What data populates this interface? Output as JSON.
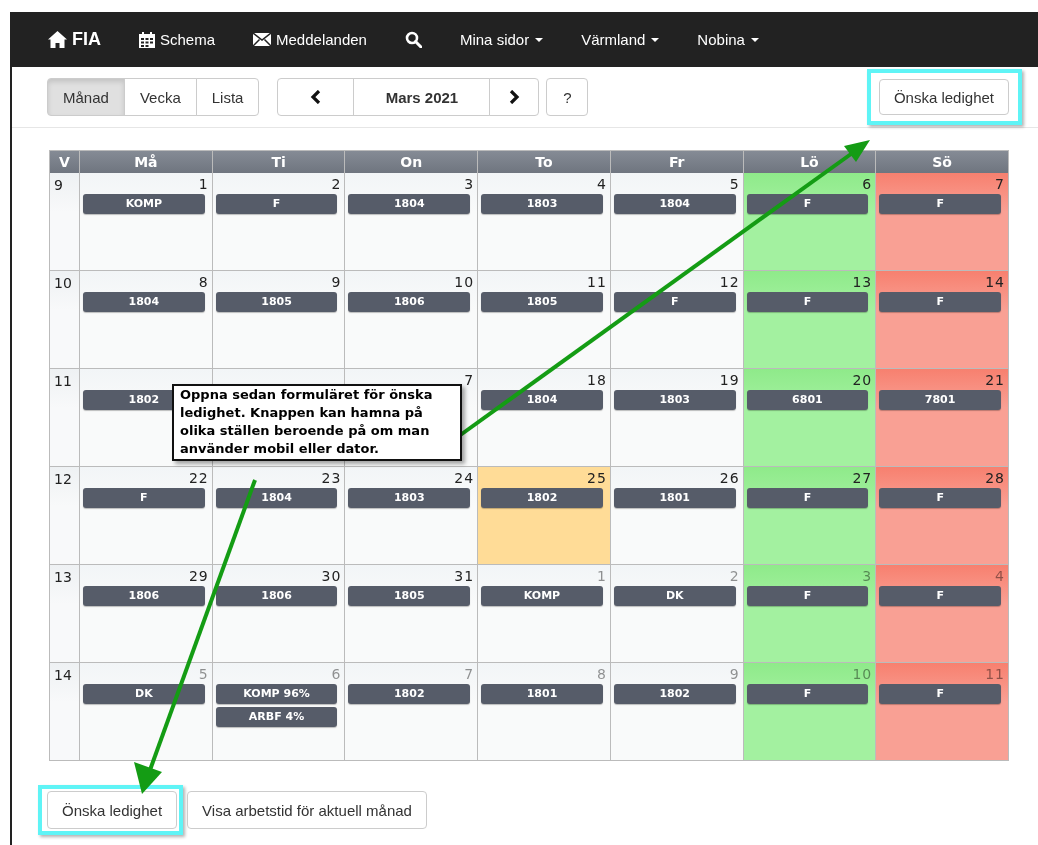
{
  "navbar": {
    "items": [
      {
        "kind": "home",
        "label": "FIA"
      },
      {
        "kind": "schedule",
        "label": "Schema"
      },
      {
        "kind": "messages",
        "label": "Meddelanden"
      },
      {
        "kind": "search"
      },
      {
        "kind": "menu",
        "label": "Mina sidor"
      },
      {
        "kind": "menu",
        "label": "Värmland"
      },
      {
        "kind": "menu",
        "label": "Nobina"
      }
    ]
  },
  "toolbar": {
    "views": [
      {
        "label": "Månad",
        "selected": true
      },
      {
        "label": "Vecka",
        "selected": false
      },
      {
        "label": "Lista",
        "selected": false
      }
    ],
    "period": "Mars 2021",
    "help": "?",
    "request_button": {
      "label": "Önska ledighet",
      "highlighted": true
    }
  },
  "calendar": {
    "week_heading": "V",
    "weekdays": [
      "Må",
      "Ti",
      "On",
      "To",
      "Fr",
      "Lö",
      "Sö"
    ],
    "weeks": [
      {
        "week": "9",
        "days": [
          {
            "date": "1",
            "kind": "day",
            "other_month": false,
            "events": [
              "KOMP"
            ]
          },
          {
            "date": "2",
            "kind": "day",
            "other_month": false,
            "events": [
              "F"
            ]
          },
          {
            "date": "3",
            "kind": "day",
            "other_month": false,
            "events": [
              "1804"
            ]
          },
          {
            "date": "4",
            "kind": "day",
            "other_month": false,
            "events": [
              "1803"
            ]
          },
          {
            "date": "5",
            "kind": "day",
            "other_month": false,
            "events": [
              "1804"
            ]
          },
          {
            "date": "6",
            "kind": "saturday",
            "other_month": false,
            "events": [
              "F"
            ]
          },
          {
            "date": "7",
            "kind": "sunday",
            "other_month": false,
            "events": [
              "F"
            ]
          }
        ]
      },
      {
        "week": "10",
        "days": [
          {
            "date": "8",
            "kind": "day",
            "other_month": false,
            "events": [
              "1804"
            ]
          },
          {
            "date": "9",
            "kind": "day",
            "other_month": false,
            "events": [
              "1805"
            ]
          },
          {
            "date": "10",
            "kind": "day",
            "other_month": false,
            "events": [
              "1806"
            ]
          },
          {
            "date": "11",
            "kind": "day",
            "other_month": false,
            "events": [
              "1805"
            ]
          },
          {
            "date": "12",
            "kind": "day",
            "other_month": false,
            "events": [
              "F"
            ]
          },
          {
            "date": "13",
            "kind": "saturday",
            "other_month": false,
            "events": [
              "F"
            ]
          },
          {
            "date": "14",
            "kind": "sunday",
            "other_month": false,
            "events": [
              "F"
            ]
          }
        ]
      },
      {
        "week": "11",
        "days": [
          {
            "kind": "day",
            "events": [
              "1802"
            ]
          },
          {
            "kind": "day"
          },
          {
            "date": "7",
            "kind": "day",
            "other_month": false
          },
          {
            "date": "18",
            "kind": "day",
            "other_month": false,
            "events": [
              "1804"
            ]
          },
          {
            "date": "19",
            "kind": "day",
            "other_month": false,
            "events": [
              "1803"
            ]
          },
          {
            "date": "20",
            "kind": "saturday",
            "other_month": false,
            "events": [
              "6801"
            ]
          },
          {
            "date": "21",
            "kind": "sunday",
            "other_month": false,
            "events": [
              "7801"
            ]
          }
        ]
      },
      {
        "week": "12",
        "days": [
          {
            "date": "22",
            "kind": "day",
            "other_month": false,
            "events": [
              "F"
            ]
          },
          {
            "date": "23",
            "kind": "day",
            "other_month": false,
            "events": [
              "1804"
            ]
          },
          {
            "date": "24",
            "kind": "day",
            "other_month": false,
            "events": [
              "1803"
            ]
          },
          {
            "date": "25",
            "kind": "today",
            "other_month": false,
            "events": [
              "1802"
            ]
          },
          {
            "date": "26",
            "kind": "day",
            "other_month": false,
            "events": [
              "1801"
            ]
          },
          {
            "date": "27",
            "kind": "saturday",
            "other_month": false,
            "events": [
              "F"
            ]
          },
          {
            "date": "28",
            "kind": "sunday",
            "other_month": false,
            "events": [
              "F"
            ]
          }
        ]
      },
      {
        "week": "13",
        "days": [
          {
            "date": "29",
            "kind": "day",
            "other_month": false,
            "events": [
              "1806"
            ]
          },
          {
            "date": "30",
            "kind": "day",
            "other_month": false,
            "events": [
              "1806"
            ]
          },
          {
            "date": "31",
            "kind": "day",
            "other_month": false,
            "events": [
              "1805"
            ]
          },
          {
            "date": "1",
            "kind": "day",
            "other_month": true,
            "events": [
              "KOMP"
            ]
          },
          {
            "date": "2",
            "kind": "day",
            "other_month": true,
            "events": [
              "DK"
            ]
          },
          {
            "date": "3",
            "kind": "saturday",
            "other_month": true,
            "events": [
              "F"
            ]
          },
          {
            "date": "4",
            "kind": "sunday",
            "other_month": true,
            "events": [
              "F"
            ]
          }
        ]
      },
      {
        "week": "14",
        "days": [
          {
            "date": "5",
            "kind": "day",
            "other_month": true,
            "events": [
              "DK"
            ]
          },
          {
            "date": "6",
            "kind": "day",
            "other_month": true,
            "events": [
              "KOMP 96%",
              "ARBF 4%"
            ]
          },
          {
            "date": "7",
            "kind": "day",
            "other_month": true,
            "events": [
              "1802"
            ]
          },
          {
            "date": "8",
            "kind": "day",
            "other_month": true,
            "events": [
              "1801"
            ]
          },
          {
            "date": "9",
            "kind": "day",
            "other_month": true,
            "events": [
              "1802"
            ]
          },
          {
            "date": "10",
            "kind": "saturday",
            "other_month": true,
            "events": [
              "F"
            ]
          },
          {
            "date": "11",
            "kind": "sunday",
            "other_month": true,
            "events": [
              "F"
            ]
          }
        ]
      }
    ]
  },
  "footer": {
    "buttons": [
      {
        "label": "Önska ledighet",
        "highlighted": true
      },
      {
        "label": "Visa arbetstid för aktuell månad",
        "highlighted": false
      }
    ]
  },
  "annotation": {
    "callout": "Oppna sedan formuläret för önska ledighet. Knappen kan hamna på olika ställen beroende på om man använder mobil eller dator."
  }
}
